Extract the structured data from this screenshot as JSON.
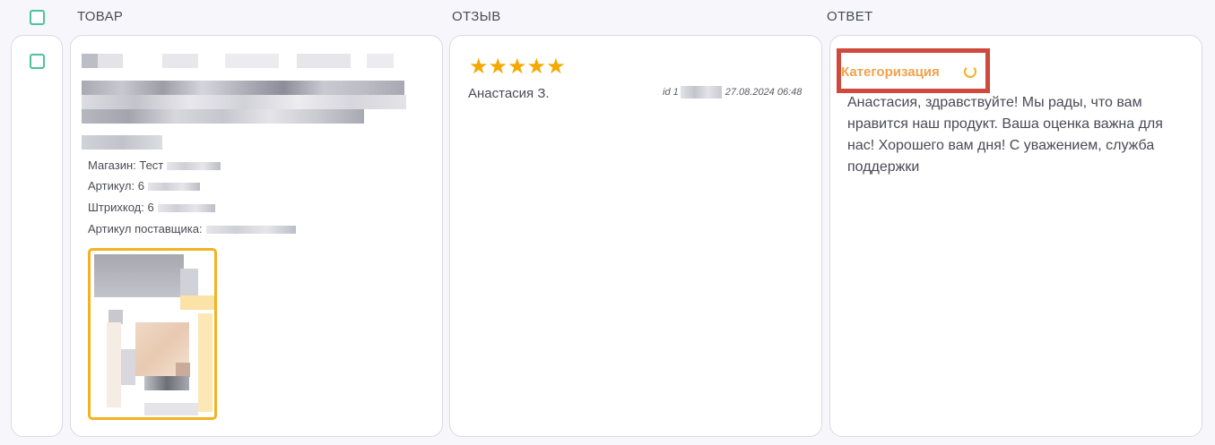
{
  "columns": {
    "product": "ТОВАР",
    "review": "ОТЗЫВ",
    "answer": "ОТВЕТ"
  },
  "product": {
    "shop_label": "Магазин: Тест",
    "article_label": "Артикул: 6",
    "barcode_label": "Штрихкод: 6",
    "supplier_article_label": "Артикул поставщика:"
  },
  "review": {
    "stars": "★★★★★",
    "rating": 5,
    "author": "Анастасия З.",
    "id_prefix": "id 1",
    "date": "27.08.2024 06:48"
  },
  "answer": {
    "category_status": "Категоризация",
    "text": "Анастасия, здравствуйте! Мы рады, что вам нравится наш продукт. Ваша оценка важна для нас! Хорошего вам дня! С уважением, служба поддержки"
  },
  "colors": {
    "accent_checkbox": "#4cc39a",
    "star": "#f5a800",
    "category": "#f0a24b",
    "highlight": "#cf4a3c",
    "thumb_border": "#f4b223"
  }
}
